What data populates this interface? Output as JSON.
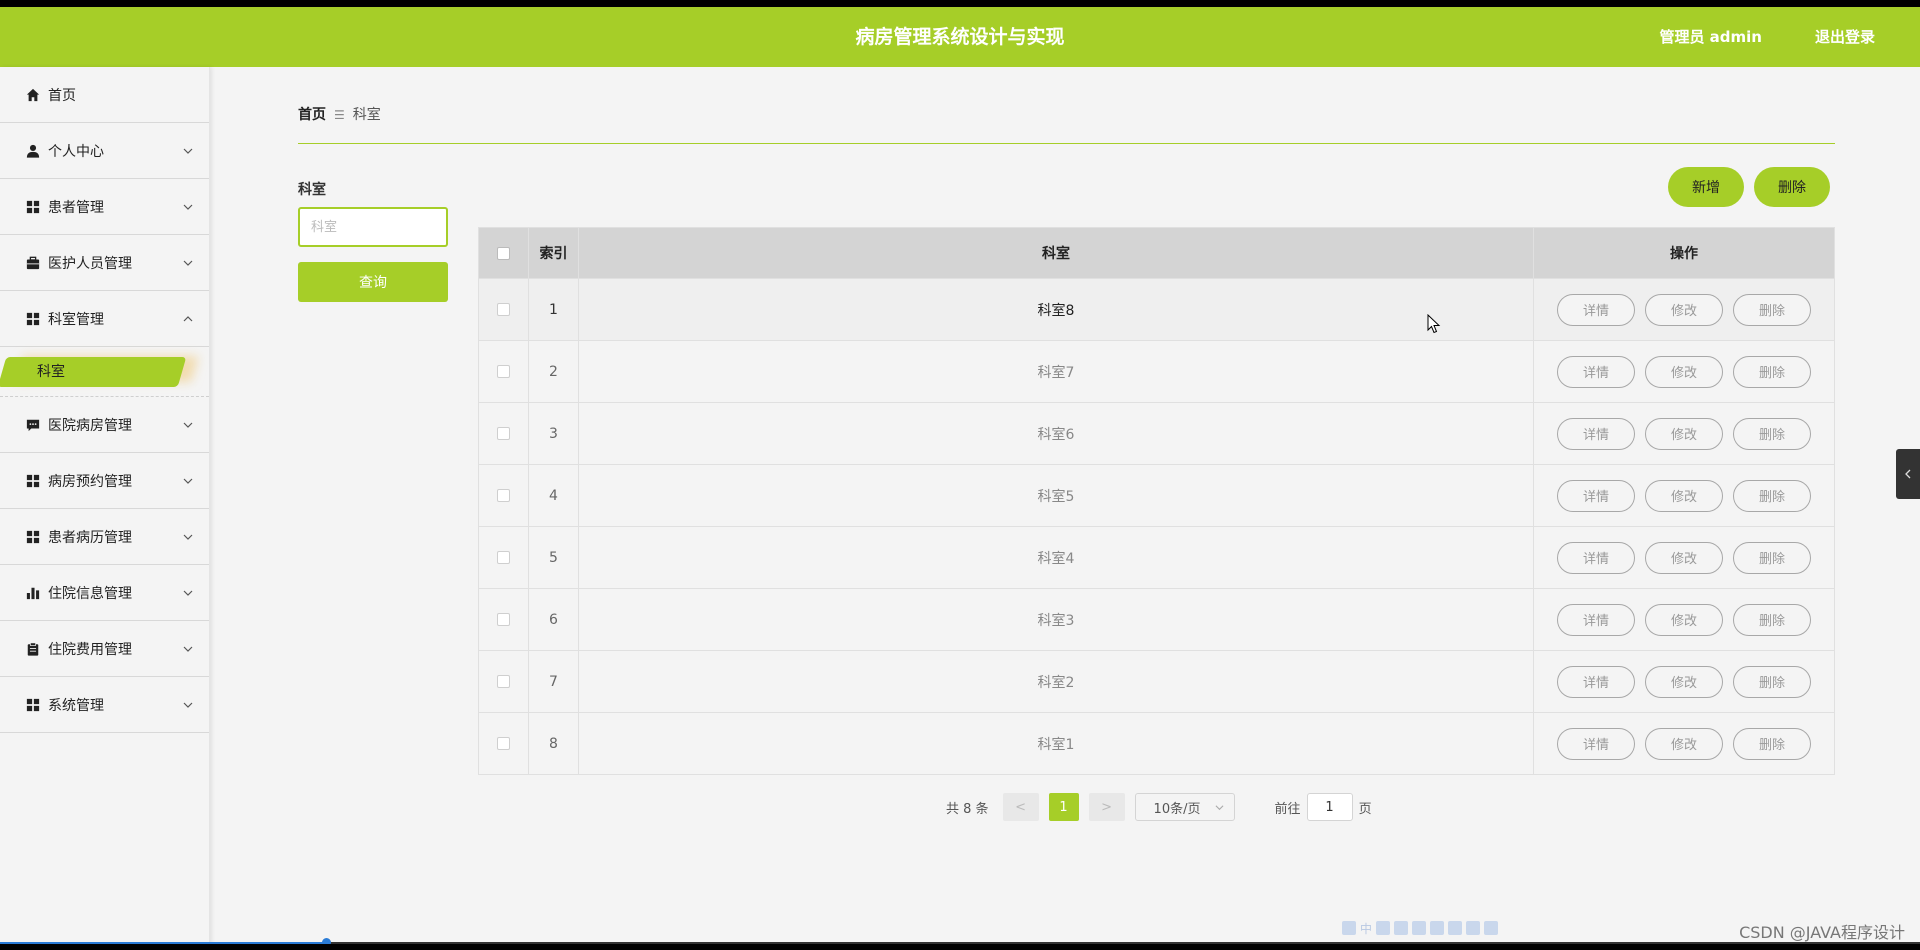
{
  "app": {
    "title": "病房管理系统设计与实现",
    "user": "管理员 admin",
    "logout": "退出登录",
    "accent_color": "#a6ce28"
  },
  "sidebar": {
    "items": [
      {
        "label": "首页",
        "icon": "home-icon",
        "expandable": false
      },
      {
        "label": "个人中心",
        "icon": "user-icon",
        "expandable": true
      },
      {
        "label": "患者管理",
        "icon": "grid-icon",
        "expandable": true
      },
      {
        "label": "医护人员管理",
        "icon": "briefcase-icon",
        "expandable": true
      },
      {
        "label": "科室管理",
        "icon": "grid-icon",
        "expandable": true,
        "expanded": true
      },
      {
        "label": "医院病房管理",
        "icon": "message-icon",
        "expandable": true
      },
      {
        "label": "病房预约管理",
        "icon": "grid-icon",
        "expandable": true
      },
      {
        "label": "患者病历管理",
        "icon": "grid-icon",
        "expandable": true
      },
      {
        "label": "住院信息管理",
        "icon": "bar-chart-icon",
        "expandable": true
      },
      {
        "label": "住院费用管理",
        "icon": "clipboard-icon",
        "expandable": true
      },
      {
        "label": "系统管理",
        "icon": "grid-icon",
        "expandable": true
      }
    ],
    "active_sub": "科室"
  },
  "breadcrumb": {
    "home": "首页",
    "separator": "☰",
    "current": "科室"
  },
  "search": {
    "label": "科室",
    "placeholder": "科室",
    "value": "",
    "button": "查询"
  },
  "actions": {
    "add": "新增",
    "delete": "删除"
  },
  "table": {
    "columns": [
      "索引",
      "科室",
      "操作"
    ],
    "rows": [
      {
        "index": "1",
        "name": "科室8"
      },
      {
        "index": "2",
        "name": "科室7"
      },
      {
        "index": "3",
        "name": "科室6"
      },
      {
        "index": "4",
        "name": "科室5"
      },
      {
        "index": "5",
        "name": "科室4"
      },
      {
        "index": "6",
        "name": "科室3"
      },
      {
        "index": "7",
        "name": "科室2"
      },
      {
        "index": "8",
        "name": "科室1"
      }
    ],
    "row_actions": {
      "detail": "详情",
      "edit": "修改",
      "delete": "删除"
    }
  },
  "pagination": {
    "total": "共 8 条",
    "prev": "<",
    "current_page": "1",
    "next": ">",
    "page_size": "10条/页",
    "goto_prefix": "前往",
    "goto_value": "1",
    "goto_suffix": "页"
  },
  "ime_bar": {
    "label": "中"
  },
  "watermark": "CSDN @JAVA程序设计",
  "video_progress": 0.17
}
